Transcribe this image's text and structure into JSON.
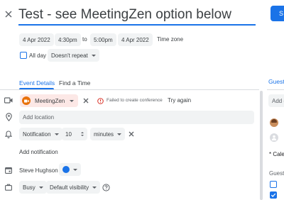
{
  "title_value": "Test - see MeetingZen option below",
  "save_label": "S",
  "date_row": {
    "start_date": "4 Apr 2022",
    "start_time": "4:30pm",
    "to_label": "to",
    "end_time": "5:00pm",
    "end_date": "4 Apr 2022",
    "timezone_label": "Time zone"
  },
  "allday_label": "All day",
  "repeat_label": "Doesn't repeat",
  "tabs": {
    "event_details": "Event Details",
    "find_time": "Find a Time"
  },
  "conference": {
    "name": "MeetingZen",
    "error_text": "Failed to create conference",
    "retry_label": "Try again"
  },
  "location_placeholder": "Add location",
  "notification": {
    "type": "Notification",
    "amount": "10",
    "unit": "minutes",
    "add_label": "Add notification"
  },
  "calendar": {
    "owner": "Steve Hughson",
    "color": "#1a73e8"
  },
  "availability": {
    "status": "Busy",
    "visibility": "Default visibility"
  },
  "guests_panel": {
    "header": "Guest",
    "add_placeholder": "Add g",
    "calendars_note": "* Cale",
    "permissions_label": "Guest"
  },
  "colors": {
    "accent": "#1a73e8",
    "conference_chip": "#fce8e6",
    "conference_logo": "#e8710a",
    "error": "#d93025"
  }
}
